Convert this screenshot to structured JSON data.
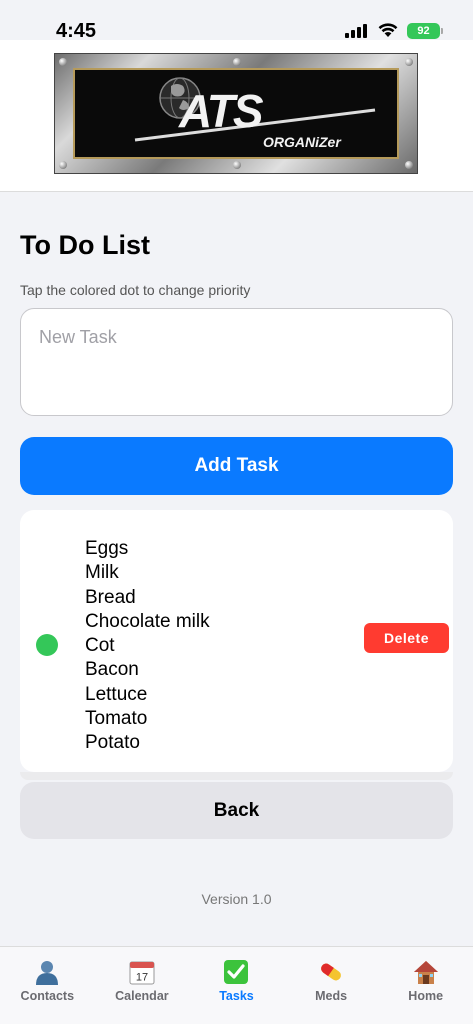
{
  "status_bar": {
    "time": "4:45",
    "battery": "92",
    "battery_color": "#34c759"
  },
  "header": {
    "logo_text": "ATS",
    "logo_subtext": "ORGANiZer"
  },
  "main": {
    "title": "To Do List",
    "hint": "Tap the colored dot to change priority",
    "new_task_placeholder": "New Task",
    "add_task_label": "Add Task",
    "task": {
      "priority_color": "#34c759",
      "lines": [
        "Eggs",
        "Milk",
        "Bread",
        "Chocolate milk",
        "Cot",
        "Bacon",
        "Lettuce",
        "Tomato",
        "Potato"
      ],
      "delete_label": "Delete"
    },
    "back_label": "Back",
    "version": "Version 1.0"
  },
  "tab_bar": {
    "accent_color": "#0a7aff",
    "items": [
      {
        "label": "Contacts",
        "icon": "contacts-icon",
        "active": false
      },
      {
        "label": "Calendar",
        "icon": "calendar-icon",
        "calendar_day": "17",
        "active": false
      },
      {
        "label": "Tasks",
        "icon": "tasks-checkmark-icon",
        "active": true
      },
      {
        "label": "Meds",
        "icon": "pill-icon",
        "active": false
      },
      {
        "label": "Home",
        "icon": "home-icon",
        "active": false
      }
    ]
  }
}
